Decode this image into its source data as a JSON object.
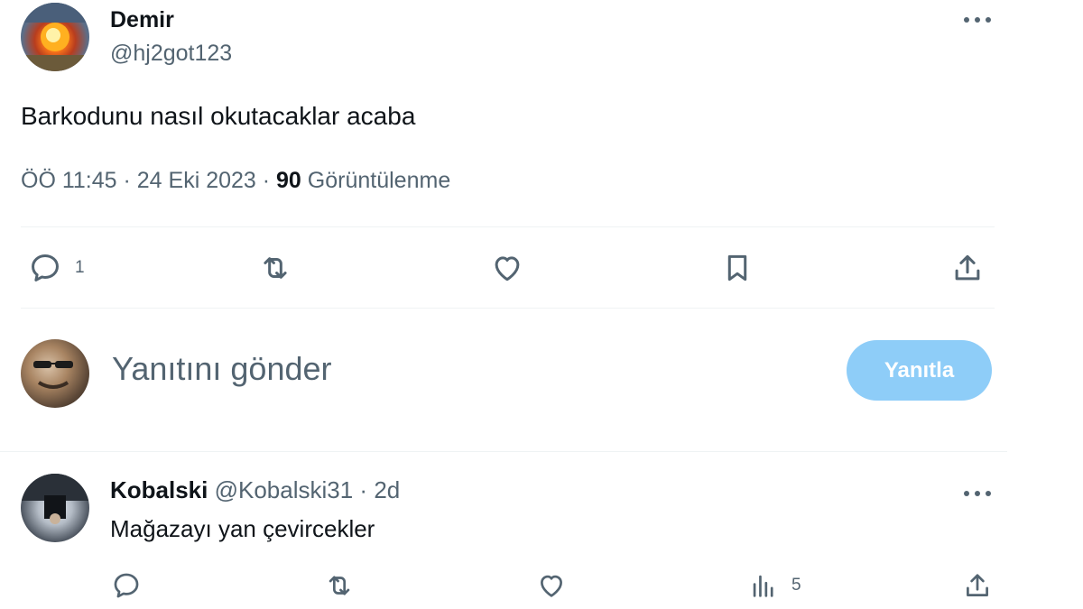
{
  "tweet": {
    "author_name": "Demir",
    "author_handle": "@hj2got123",
    "text": "Barkodunu nasıl okutacaklar acaba",
    "time": "ÖÖ 11:45",
    "separator1": " · ",
    "date": "24 Eki 2023",
    "separator2": " · ",
    "views_count": "90",
    "views_label": "Görüntülenme",
    "actions": {
      "reply_icon": "reply-icon",
      "reply_count": "1",
      "retweet_icon": "retweet-icon",
      "like_icon": "heart-icon",
      "bookmark_icon": "bookmark-icon",
      "share_icon": "share-icon"
    }
  },
  "compose": {
    "placeholder": "Yanıtını gönder",
    "button_label": "Yanıtla",
    "button_color": "#8ecdf8"
  },
  "reply": {
    "author_name": "Kobalski",
    "author_handle": "@Kobalski31",
    "separator": " · ",
    "time": "2d",
    "text": "Mağazayı yan çevircekler",
    "views_count": "5"
  },
  "colors": {
    "text_primary": "#0f1419",
    "text_secondary": "#536471",
    "divider": "#eff3f4"
  }
}
